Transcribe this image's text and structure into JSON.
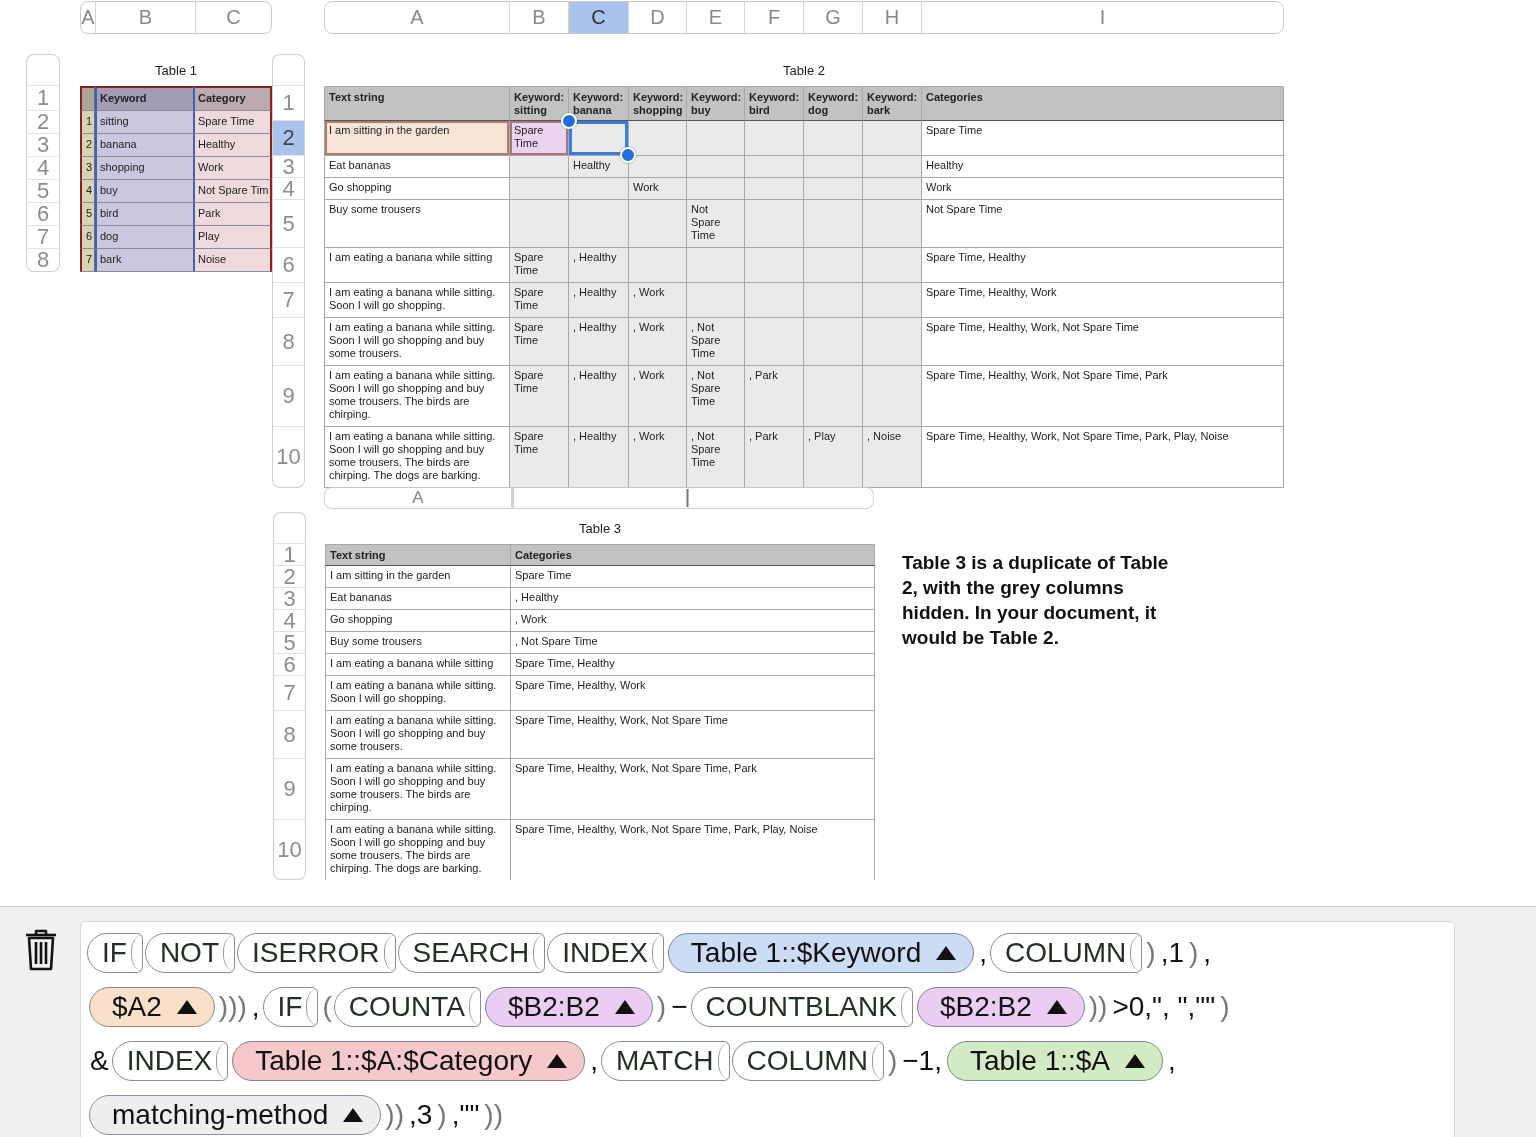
{
  "table1": {
    "column_header_bar": [
      {
        "label": "A",
        "selected": false
      },
      {
        "label": "B",
        "selected": false
      },
      {
        "label": "C",
        "selected": false
      }
    ],
    "row_header": [
      "1",
      "2",
      "3",
      "4",
      "5",
      "6",
      "7",
      "8"
    ],
    "title": "Table 1",
    "columns": [
      {
        "kind": "index",
        "color": "#d9d3b6"
      },
      {
        "kind": "data",
        "label": "Keyword",
        "color": "#cbc7de"
      },
      {
        "kind": "data",
        "label": "Category",
        "color": "#eed9dc"
      }
    ],
    "rows": [
      [
        "1",
        "sitting",
        "Spare Time"
      ],
      [
        "2",
        "banana",
        "Healthy"
      ],
      [
        "3",
        "shopping",
        "Work"
      ],
      [
        "4",
        "buy",
        "Not Spare Tim"
      ],
      [
        "5",
        "bird",
        "Park"
      ],
      [
        "6",
        "dog",
        "Play"
      ],
      [
        "7",
        "bark",
        "Noise"
      ]
    ]
  },
  "table2": {
    "column_header_bar": [
      {
        "label": "A",
        "selected": false
      },
      {
        "label": "B",
        "selected": false
      },
      {
        "label": "C",
        "selected": true
      },
      {
        "label": "D",
        "selected": false
      },
      {
        "label": "E",
        "selected": false
      },
      {
        "label": "F",
        "selected": false
      },
      {
        "label": "G",
        "selected": false
      },
      {
        "label": "H",
        "selected": false
      },
      {
        "label": "I",
        "selected": false
      }
    ],
    "row_header": [
      {
        "label": "1",
        "selected": false
      },
      {
        "label": "2",
        "selected": true
      },
      {
        "label": "3",
        "selected": false
      },
      {
        "label": "4",
        "selected": false
      },
      {
        "label": "5",
        "selected": false
      },
      {
        "label": "6",
        "selected": false
      },
      {
        "label": "7",
        "selected": false
      },
      {
        "label": "8",
        "selected": false
      },
      {
        "label": "9",
        "selected": false
      },
      {
        "label": "10",
        "selected": false
      }
    ],
    "title": "Table 2",
    "columns": [
      {
        "label": "Text string",
        "kind": "text"
      },
      {
        "label": "Keyword: sitting",
        "kind": "keyword"
      },
      {
        "label": "Keyword: banana",
        "kind": "keyword"
      },
      {
        "label": "Keyword: shopping",
        "kind": "keyword"
      },
      {
        "label": "Keyword: buy",
        "kind": "keyword"
      },
      {
        "label": "Keyword: bird",
        "kind": "keyword"
      },
      {
        "label": "Keyword: dog",
        "kind": "keyword"
      },
      {
        "label": "Keyword: bark",
        "kind": "keyword"
      },
      {
        "label": "Categories",
        "kind": "categories"
      }
    ],
    "rows": [
      {
        "cells": [
          "I am sitting in the garden",
          "Spare Time",
          null,
          null,
          null,
          null,
          null,
          null,
          "Spare Time"
        ],
        "cell_states": [
          {
            "kind": "reference",
            "color": "#f8e4d6"
          },
          {
            "kind": "reference",
            "color": "#ebd3f2"
          },
          {
            "kind": "selected"
          }
        ]
      },
      {
        "cells": [
          "Eat bananas",
          null,
          "Healthy",
          null,
          null,
          null,
          null,
          null,
          "Healthy"
        ]
      },
      {
        "cells": [
          "Go shopping",
          null,
          null,
          "Work",
          null,
          null,
          null,
          null,
          "Work"
        ]
      },
      {
        "cells": [
          "Buy some trousers",
          null,
          null,
          null,
          "Not Spare Time",
          null,
          null,
          null,
          "Not Spare Time"
        ]
      },
      {
        "cells": [
          "I am eating a banana while sitting",
          "Spare Time",
          ", Healthy",
          null,
          null,
          null,
          null,
          null,
          "Spare Time, Healthy"
        ]
      },
      {
        "cells": [
          "I am eating a banana while sitting. Soon I will go shopping.",
          "Spare Time",
          ", Healthy",
          ", Work",
          null,
          null,
          null,
          null,
          "Spare Time, Healthy, Work"
        ]
      },
      {
        "cells": [
          "I am eating a banana while sitting. Soon I will go shopping and buy some trousers.",
          "Spare Time",
          ", Healthy",
          ", Work",
          ", Not Spare Time",
          null,
          null,
          null,
          "Spare Time, Healthy, Work, Not Spare Time"
        ]
      },
      {
        "cells": [
          "I am eating a banana while sitting. Soon I will go shopping and buy some trousers. The birds are chirping.",
          "Spare Time",
          ", Healthy",
          ", Work",
          ", Not Spare Time",
          ", Park",
          null,
          null,
          "Spare Time, Healthy, Work, Not Spare Time, Park"
        ]
      },
      {
        "cells": [
          "I am eating a banana while sitting. Soon I will go shopping and buy some trousers. The birds are chirping. The dogs are barking.",
          "Spare Time",
          ", Healthy",
          ", Work",
          ", Not Spare Time",
          ", Park",
          ", Play",
          ", Noise",
          "Spare Time, Healthy, Work, Not Spare Time, Park, Play, Noise"
        ]
      }
    ],
    "ghost_header": {
      "label": "A"
    }
  },
  "table3": {
    "row_header": [
      "1",
      "2",
      "3",
      "4",
      "5",
      "6",
      "7",
      "8",
      "9",
      "10"
    ],
    "title": "Table 3",
    "columns": [
      "Text string",
      "Categories"
    ],
    "rows": [
      [
        "I am sitting in the garden",
        "Spare Time"
      ],
      [
        "Eat bananas",
        ", Healthy"
      ],
      [
        "Go shopping",
        ", Work"
      ],
      [
        "Buy some trousers",
        ", Not Spare Time"
      ],
      [
        "I am eating a banana while sitting",
        "Spare Time, Healthy"
      ],
      [
        "I am eating a banana while sitting. Soon I will go shopping.",
        "Spare Time, Healthy, Work"
      ],
      [
        "I am eating a banana while sitting. Soon I will go shopping and buy some trousers.",
        "Spare Time, Healthy, Work, Not Spare Time"
      ],
      [
        "I am eating a banana while sitting. Soon I will go shopping and buy some trousers. The birds are chirping.",
        "Spare Time, Healthy, Work, Not Spare Time, Park"
      ],
      [
        "I am eating a banana while sitting. Soon I will go shopping and buy some trousers. The birds are chirping. The dogs are barking.",
        "Spare Time, Healthy, Work, Not Spare Time, Park, Play, Noise"
      ]
    ]
  },
  "note": "Table 3 is a duplicate of Table 2, with the grey columns hidden. In your document, it would be Table 2.",
  "formula": {
    "lines": [
      {
        "tokens": [
          {
            "kind": "func",
            "text": "IF"
          },
          {
            "kind": "func",
            "text": "NOT"
          },
          {
            "kind": "func",
            "text": "ISERROR"
          },
          {
            "kind": "func",
            "text": "SEARCH"
          },
          {
            "kind": "func",
            "text": "INDEX"
          },
          {
            "kind": "ref",
            "text": "Table 1::$Keyword",
            "color": "#cddcf5"
          },
          {
            "kind": "text",
            "text": ","
          },
          {
            "kind": "func",
            "text": "COLUMN"
          },
          {
            "kind": "close",
            "text": ")"
          },
          {
            "kind": "text",
            "text": ",1"
          },
          {
            "kind": "close",
            "text": ")"
          },
          {
            "kind": "text",
            "text": ","
          }
        ]
      },
      {
        "tokens": [
          {
            "kind": "ref",
            "text": "$A2",
            "color": "#f8e0c8"
          },
          {
            "kind": "close",
            "text": ")))"
          },
          {
            "kind": "text",
            "text": ","
          },
          {
            "kind": "func",
            "text": "IF"
          },
          {
            "kind": "close",
            "text": "("
          },
          {
            "kind": "func",
            "text": "COUNTA"
          },
          {
            "kind": "ref",
            "text": "$B2:B2",
            "color": "#ebcdf3"
          },
          {
            "kind": "close",
            "text": ")"
          },
          {
            "kind": "text",
            "text": "−"
          },
          {
            "kind": "func",
            "text": "COUNTBLANK"
          },
          {
            "kind": "ref",
            "text": "$B2:B2",
            "color": "#ebcdf2"
          },
          {
            "kind": "close",
            "text": "))"
          },
          {
            "kind": "text",
            "text": ">0,\", \",\"\""
          },
          {
            "kind": "close",
            "text": ")"
          }
        ]
      },
      {
        "tokens": [
          {
            "kind": "text",
            "text": "&"
          },
          {
            "kind": "func",
            "text": "INDEX"
          },
          {
            "kind": "ref",
            "text": "Table 1::$A:$Category",
            "color": "#f5c9c9"
          },
          {
            "kind": "text",
            "text": ","
          },
          {
            "kind": "func",
            "text": "MATCH"
          },
          {
            "kind": "func",
            "text": "COLUMN"
          },
          {
            "kind": "close",
            "text": ")"
          },
          {
            "kind": "text",
            "text": "−1,"
          },
          {
            "kind": "ref",
            "text": "Table 1::$A",
            "color": "#d3ebc4"
          },
          {
            "kind": "text",
            "text": ","
          }
        ]
      },
      {
        "tokens": [
          {
            "kind": "ref",
            "text": "matching-method",
            "color": "#eeeeee"
          },
          {
            "kind": "close",
            "text": "))"
          },
          {
            "kind": "text",
            "text": ",3"
          },
          {
            "kind": "close",
            "text": ")"
          },
          {
            "kind": "text",
            "text": ",\"\""
          },
          {
            "kind": "close",
            "text": "))"
          }
        ]
      }
    ]
  }
}
